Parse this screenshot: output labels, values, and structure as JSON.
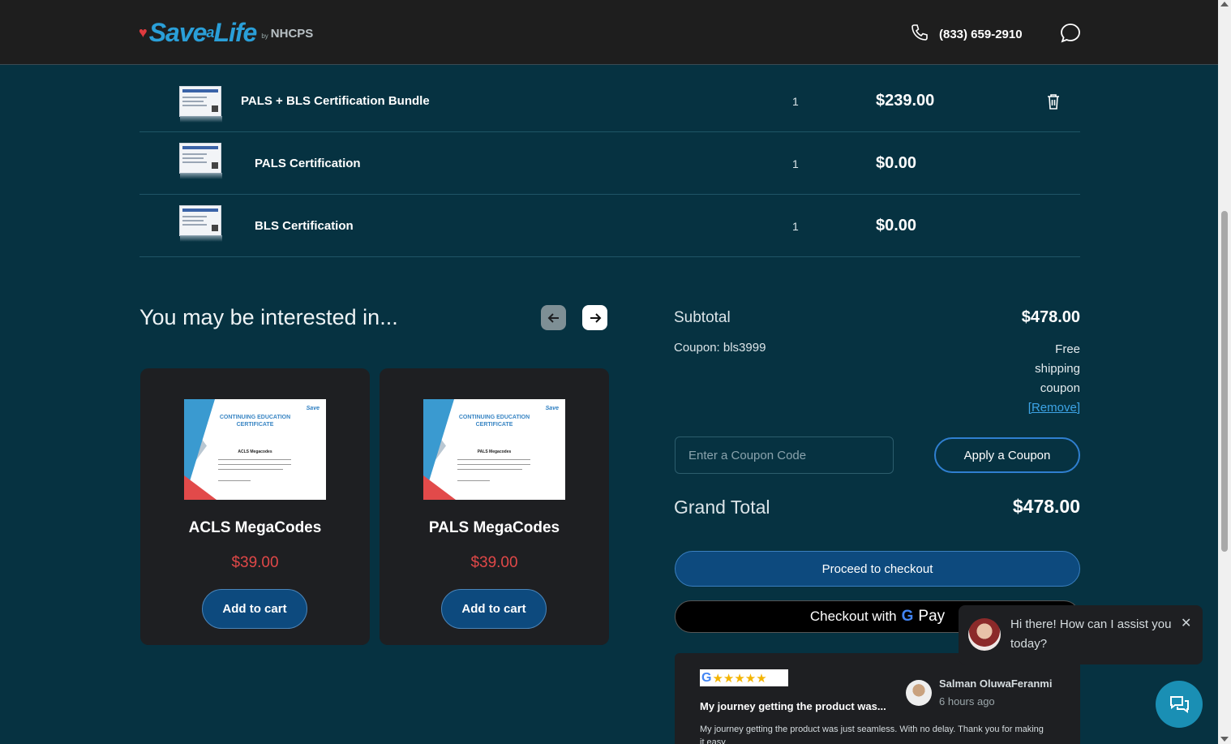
{
  "header": {
    "brand_save": "Save",
    "brand_a": "a",
    "brand_life": "Life",
    "brand_by": "by",
    "brand_org": "NHCPS",
    "phone": "(833) 659-2910"
  },
  "cart": {
    "items": [
      {
        "name": "PALS + BLS Certification Bundle",
        "qty": "1",
        "price": "$239.00"
      },
      {
        "name": "PALS Certification",
        "qty": "1",
        "price": "$0.00"
      },
      {
        "name": "BLS Certification",
        "qty": "1",
        "price": "$0.00"
      }
    ]
  },
  "recommendations": {
    "title": "You may be interested in...",
    "cards": [
      {
        "cert_title": "CONTINUING EDUCATION CERTIFICATE",
        "cert_course": "ACLS Megacodes",
        "name": "ACLS MegaCodes",
        "price": "$39.00",
        "button": "Add to cart"
      },
      {
        "cert_title": "CONTINUING EDUCATION CERTIFICATE",
        "cert_course": "PALS Megacodes",
        "name": "PALS MegaCodes",
        "price": "$39.00",
        "button": "Add to cart"
      }
    ]
  },
  "summary": {
    "subtotal_label": "Subtotal",
    "subtotal_value": "$478.00",
    "coupon_label": "Coupon: bls3999",
    "coupon_desc": "Free shipping coupon",
    "coupon_remove": "[Remove]",
    "coupon_placeholder": "Enter a Coupon Code",
    "apply_button": "Apply a Coupon",
    "grand_total_label": "Grand Total",
    "grand_total_value": "$478.00",
    "checkout_button": "Proceed to checkout",
    "gpay_prefix": "Checkout with",
    "gpay_g": "G",
    "gpay_pay": "Pay"
  },
  "review": {
    "stars_g": "G",
    "stars": "★★★★★",
    "title": "My journey getting the product was...",
    "name": "Salman OluwaFeranmi",
    "time": "6 hours ago",
    "text": "My journey getting the product was just seamless. With no delay. Thank you for making it easy"
  },
  "chat": {
    "message": "Hi there! How can I assist you today?",
    "close": "✕"
  },
  "colors": {
    "background": "#063241",
    "header": "#1e1e1e",
    "accent_blue": "#0d4a7e",
    "price_red": "#e04848"
  }
}
